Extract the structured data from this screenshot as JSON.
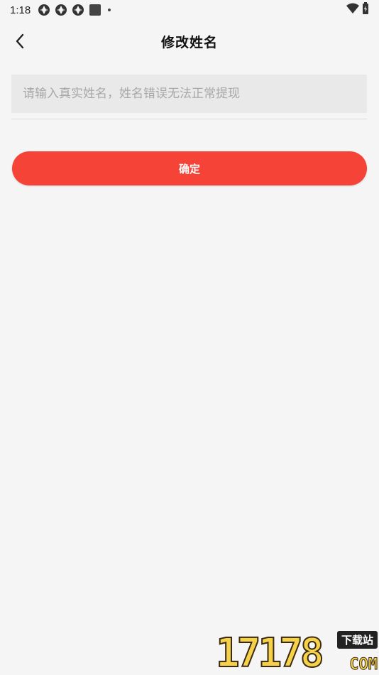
{
  "status_bar": {
    "time": "1:18"
  },
  "nav": {
    "title": "修改姓名"
  },
  "form": {
    "name_placeholder": "请输入真实姓名，姓名错误无法正常提现",
    "name_value": "",
    "confirm_label": "确定"
  },
  "watermark": {
    "digits": "17178",
    "tag": "下载站",
    "suffix": "COM"
  },
  "colors": {
    "accent": "#f54337",
    "background": "#f5f5f5",
    "input_background": "#e9e9e9"
  }
}
